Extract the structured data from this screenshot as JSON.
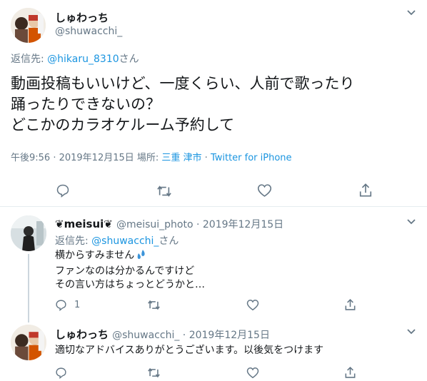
{
  "main_tweet": {
    "display_name": "しゅわっち",
    "handle": "@shuwacchi_",
    "reply_prefix": "返信先: ",
    "reply_to": "@hikaru_8310",
    "reply_suffix": "さん",
    "text_line1": "動画投稿もいいけど、一度くらい、人前で歌ったり",
    "text_line2": "踊ったりできないの？",
    "text_line3": "どこかのカラオケルーム予約して",
    "meta_time": "午後9:56 · 2019年12月15日 場所: ",
    "meta_place": "三重 津市",
    "meta_sep": " · ",
    "meta_source": "Twitter for iPhone"
  },
  "reply1": {
    "display_name": "❦meisui❦",
    "handle": "@meisui_photo",
    "sep": " · ",
    "date": "2019年12月15日",
    "reply_prefix": "返信先: ",
    "reply_to": "@shuwacchi_",
    "reply_suffix": "さん",
    "text_line1": "横からすみません",
    "text_line2": "ファンなのは分かるんですけど",
    "text_line3": "その言い方はちょっとどうかと…",
    "reply_count": "1"
  },
  "reply2": {
    "display_name": "しゅわっち",
    "handle": "@shuwacchi_",
    "sep": " · ",
    "date": "2019年12月15日",
    "text_line1": "適切なアドバイスありがとうございます。以後気をつけます"
  },
  "icons": [
    "reply-icon",
    "retweet-icon",
    "like-icon",
    "share-icon",
    "chevron-down-icon",
    "sweat-drops-icon"
  ],
  "colors": {
    "link": "#1b95e0",
    "secondary": "#657786",
    "divider": "#e6ecf0",
    "thread_line": "#ccd6dd"
  }
}
